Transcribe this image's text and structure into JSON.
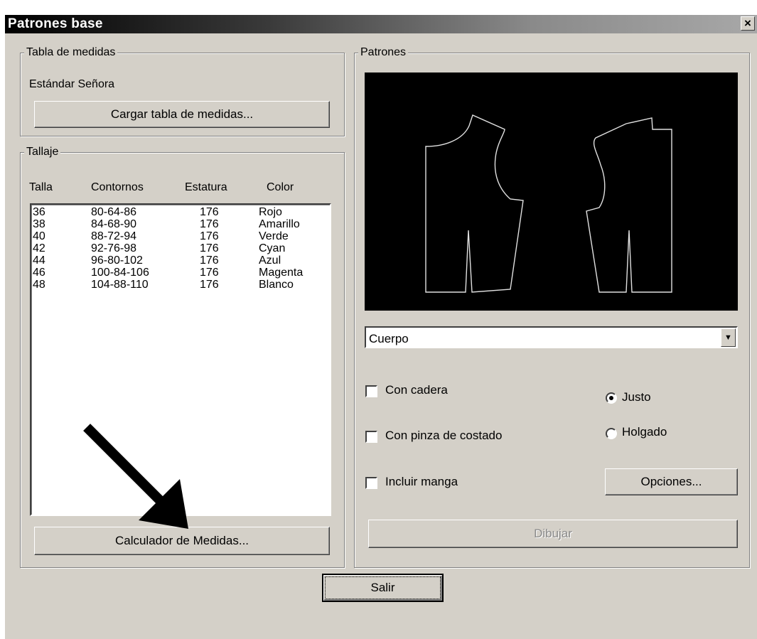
{
  "window": {
    "title": "Patrones base",
    "close_symbol": "×"
  },
  "tabla_medidas": {
    "legend": "Tabla de medidas",
    "current_table": "Estándar Señora",
    "load_button": "Cargar tabla de medidas..."
  },
  "tallaje": {
    "legend": "Tallaje",
    "columns": [
      "Talla",
      "Contornos",
      "Estatura",
      "Color"
    ],
    "rows": [
      {
        "talla": "36",
        "contornos": "80-64-86",
        "estatura": "176",
        "color": "Rojo"
      },
      {
        "talla": "38",
        "contornos": "84-68-90",
        "estatura": "176",
        "color": "Amarillo"
      },
      {
        "talla": "40",
        "contornos": "88-72-94",
        "estatura": "176",
        "color": "Verde"
      },
      {
        "talla": "42",
        "contornos": "92-76-98",
        "estatura": "176",
        "color": "Cyan"
      },
      {
        "talla": "44",
        "contornos": "96-80-102",
        "estatura": "176",
        "color": "Azul"
      },
      {
        "talla": "46",
        "contornos": "100-84-106",
        "estatura": "176",
        "color": "Magenta"
      },
      {
        "talla": "48",
        "contornos": "104-88-110",
        "estatura": "176",
        "color": "Blanco"
      }
    ],
    "calc_button": "Calculador de Medidas..."
  },
  "patrones": {
    "legend": "Patrones",
    "select_value": "Cuerpo",
    "checkboxes": [
      {
        "label": "Con cadera",
        "checked": false
      },
      {
        "label": "Con pinza de costado",
        "checked": false
      },
      {
        "label": "Incluir manga",
        "checked": false
      }
    ],
    "radios": [
      {
        "label": "Justo",
        "selected": true
      },
      {
        "label": "Holgado",
        "selected": false
      }
    ],
    "options_button": "Opciones...",
    "draw_button": "Dibujar"
  },
  "exit_button": "Salir",
  "colors": {
    "face": "#d4d0c8",
    "canvas": "#000000",
    "pattern_line": "#e0e0e0"
  }
}
